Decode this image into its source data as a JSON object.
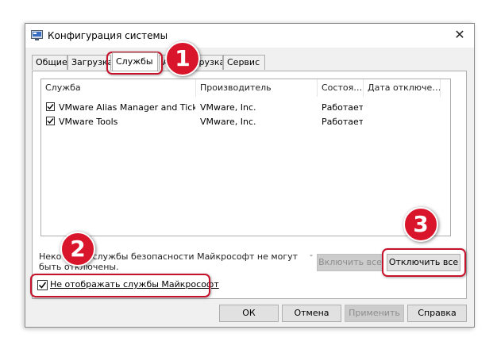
{
  "window": {
    "title": "Конфигурация системы",
    "close_glyph": "✕"
  },
  "tabs": [
    {
      "label": "Общие"
    },
    {
      "label": "Загрузка"
    },
    {
      "label": "Службы"
    },
    {
      "label": "Автозагрузка"
    },
    {
      "label": "Сервис"
    }
  ],
  "services": {
    "columns": [
      "Служба",
      "Производитель",
      "Состоя…",
      "Дата отключе…"
    ],
    "rows": [
      {
        "checked": true,
        "name": "VMware Alias Manager and Ticke…",
        "vendor": "VMware, Inc.",
        "status": "Работает",
        "date": ""
      },
      {
        "checked": true,
        "name": "VMware Tools",
        "vendor": "VMware, Inc.",
        "status": "Работает",
        "date": ""
      }
    ]
  },
  "note": "Некоторые службы безопасности Майкрософт не могут быть отключены.",
  "buttons": {
    "enable_all": "Включить все",
    "disable_all": "Отключить все",
    "ok": "ОК",
    "cancel": "Отмена",
    "apply": "Применить",
    "help": "Справка"
  },
  "hide_ms": {
    "checked": true,
    "label": "Не отображать службы Майкрософт"
  },
  "annotations": {
    "badge1": "1",
    "badge2": "2",
    "badge3": "3"
  },
  "colors": {
    "highlight": "#c6122b",
    "badge": "#d9152c"
  }
}
